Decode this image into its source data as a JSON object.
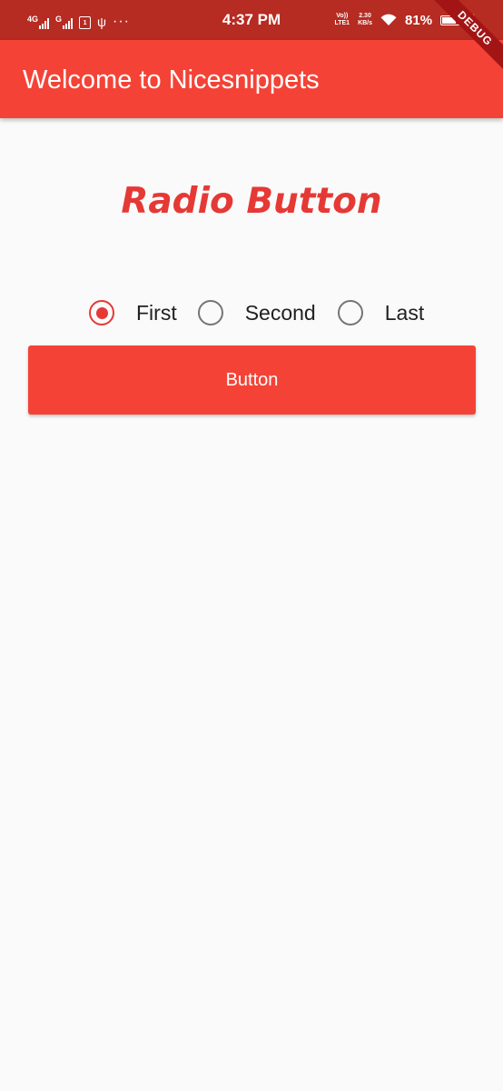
{
  "status_bar": {
    "network1": "4G",
    "network2": "G",
    "sim_label": "1",
    "overflow": "···",
    "time": "4:37 PM",
    "volte_line1": "Vo))",
    "volte_line2": "LTE1",
    "speed_value": "2.30",
    "speed_unit": "KB/s",
    "battery_percent": "81%",
    "battery_level": 0.81,
    "icons": [
      "signal-icon",
      "sim-icon",
      "usb-icon",
      "wifi-icon",
      "battery-icon",
      "charging-icon"
    ]
  },
  "debug_banner": "DEBUG",
  "app_bar": {
    "title": "Welcome to Nicesnippets"
  },
  "heading": "Radio Button",
  "radio_group": {
    "selected": "First",
    "options": [
      "First",
      "Second",
      "Last"
    ]
  },
  "button": {
    "label": "Button"
  },
  "colors": {
    "status_bar": "#b62b22",
    "primary": "#f44336",
    "accent": "#e53935",
    "background": "#fafafa"
  }
}
